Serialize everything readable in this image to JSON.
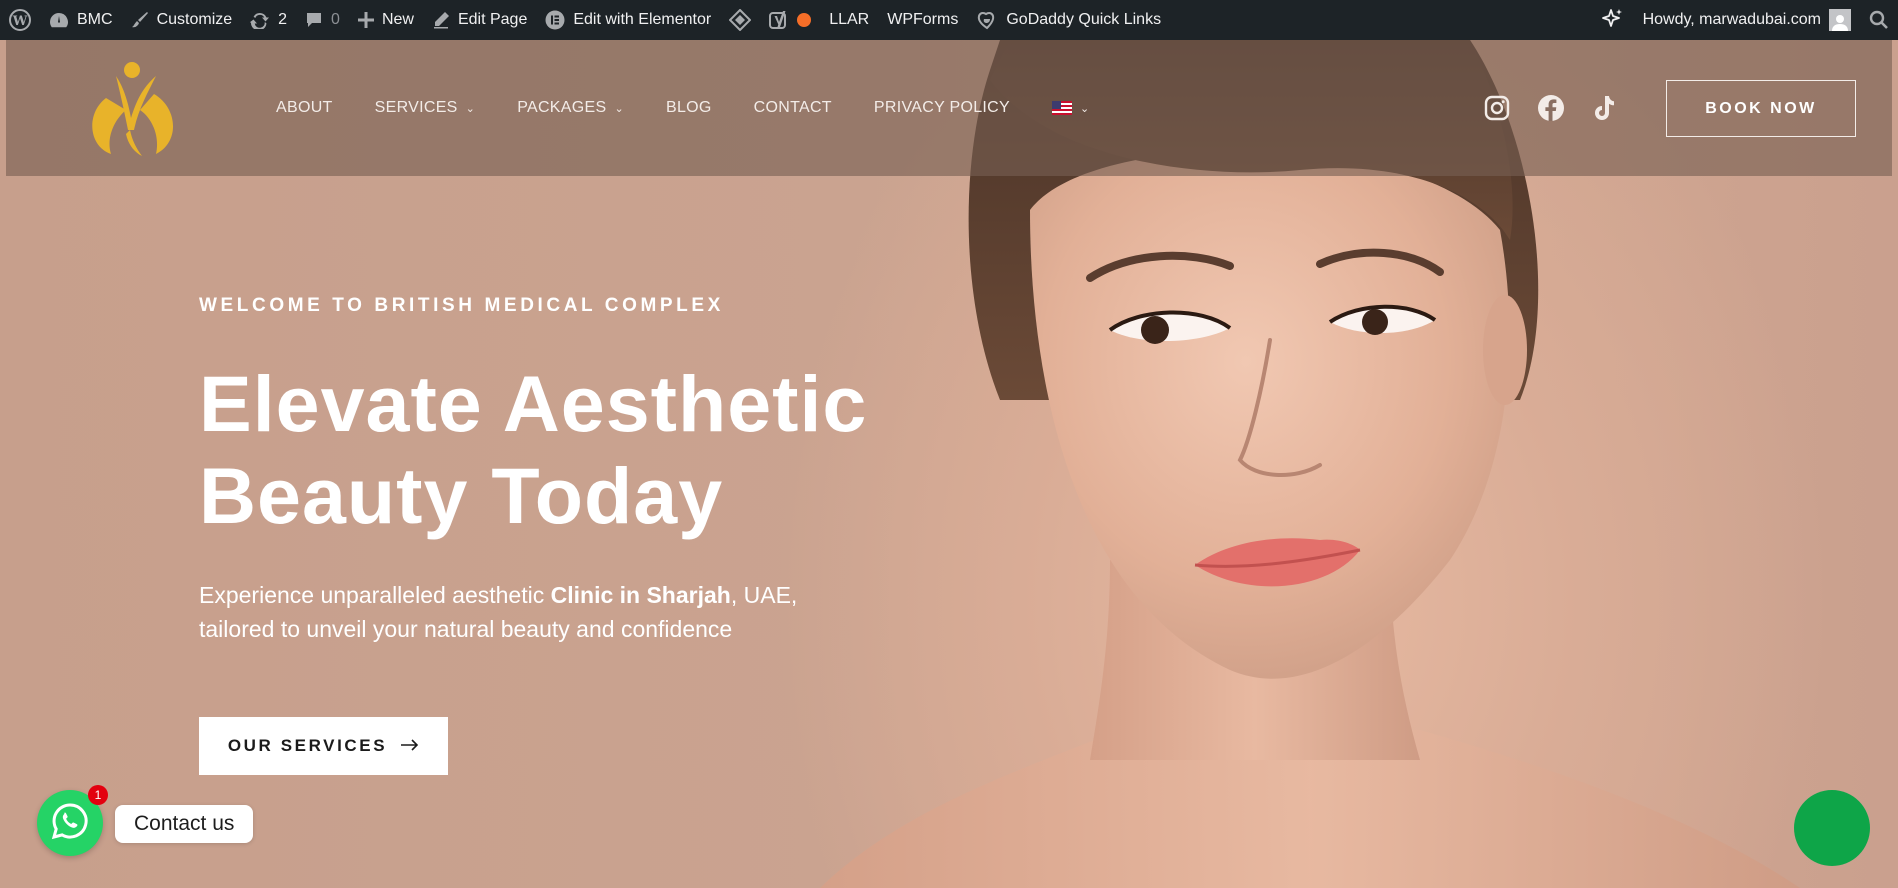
{
  "admin_bar": {
    "site_name": "BMC",
    "customize": "Customize",
    "updates_count": "2",
    "comments_count": "0",
    "new_label": "New",
    "edit_page": "Edit Page",
    "edit_elementor": "Edit with Elementor",
    "llar": "LLAR",
    "wpforms": "WPForms",
    "godaddy": "GoDaddy Quick Links",
    "howdy": "Howdy, marwadubai.com"
  },
  "nav": {
    "items": [
      {
        "label": "ABOUT",
        "dropdown": false
      },
      {
        "label": "SERVICES",
        "dropdown": true
      },
      {
        "label": "PACKAGES",
        "dropdown": true
      },
      {
        "label": "BLOG",
        "dropdown": false
      },
      {
        "label": "CONTACT",
        "dropdown": false
      },
      {
        "label": "PRIVACY POLICY",
        "dropdown": false
      }
    ],
    "book_now": "BOOK NOW"
  },
  "hero": {
    "eyebrow": "WELCOME TO BRITISH MEDICAL COMPLEX",
    "headline_line1": "Elevate Aesthetic",
    "headline_line2": "Beauty Today",
    "sub_part1": "Experience unparalleled aesthetic ",
    "sub_bold": "Clinic in Sharjah",
    "sub_part2": ", UAE,",
    "sub_line2": "tailored to unveil your natural beauty and confidence",
    "cta_label": "OUR SERVICES"
  },
  "chat": {
    "badge_count": "1",
    "label": "Contact us"
  },
  "colors": {
    "admin_bar_bg": "#1d2327",
    "logo_gold": "#e8b32a",
    "whatsapp_green": "#25d366",
    "fab_green": "#0ea548",
    "badge_red": "#e3000f"
  }
}
